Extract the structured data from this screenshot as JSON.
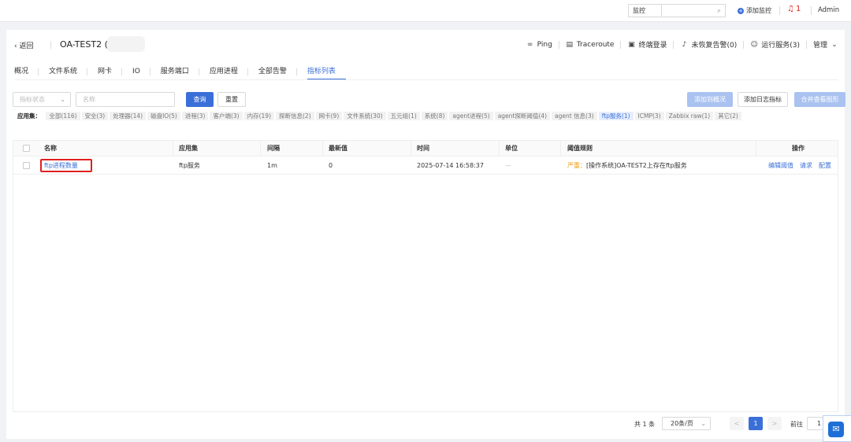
{
  "topbar": {
    "select_value": "监控",
    "add_monitor": "添加监控",
    "alert_count": "1",
    "user": "Admin"
  },
  "header": {
    "back_label": "返回",
    "host_name": "OA-TEST2 (17",
    "actions": [
      "Ping",
      "Traceroute",
      "终端登录",
      "未恢复告警(0)",
      "运行服务(3)",
      "管理"
    ]
  },
  "tabs": [
    "概况",
    "文件系统",
    "网卡",
    "IO",
    "服务端口",
    "应用进程",
    "全部告警",
    "指标列表"
  ],
  "filter": {
    "status_placeholder": "指标状态",
    "name_placeholder": "名称",
    "query_label": "查询",
    "reset_label": "重置",
    "add_overview_label": "添加到概况",
    "add_log_label": "添加日志指标",
    "merge_label": "合并查看图形"
  },
  "appset": {
    "label": "应用集：",
    "chips": [
      "全部(116)",
      "安全(3)",
      "处理器(14)",
      "磁盘IO(5)",
      "进程(3)",
      "客户端(3)",
      "内存(19)",
      "探断信息(2)",
      "网卡(9)",
      "文件系统(30)",
      "五元组(1)",
      "系统(8)",
      "agent进程(5)",
      "agent探断阈值(4)",
      "agent 信息(3)",
      "ftp服务(1)",
      "ICMP(3)",
      "Zabbix raw(1)",
      "其它(2)"
    ],
    "active_index": 15
  },
  "table": {
    "headers": [
      "名称",
      "应用集",
      "间隔",
      "最新值",
      "时间",
      "单位",
      "阈值规则",
      "操作"
    ],
    "rows": [
      {
        "name": "ftp进程数量",
        "appset": "ftp服务",
        "interval": "1m",
        "latest": "0",
        "time": "2025-07-14 16:58:37",
        "unit": "—",
        "rule_level": "严重：",
        "rule_text": "[操作系统]OA-TEST2上存在ftp服务",
        "ops": [
          "编辑阈值",
          "请求",
          "配置"
        ]
      }
    ]
  },
  "pager": {
    "total": "共 1 条",
    "page_size": "20条/页",
    "prev": "<",
    "current": "1",
    "next": ">",
    "goto_label": "前往",
    "goto_value": "1"
  }
}
